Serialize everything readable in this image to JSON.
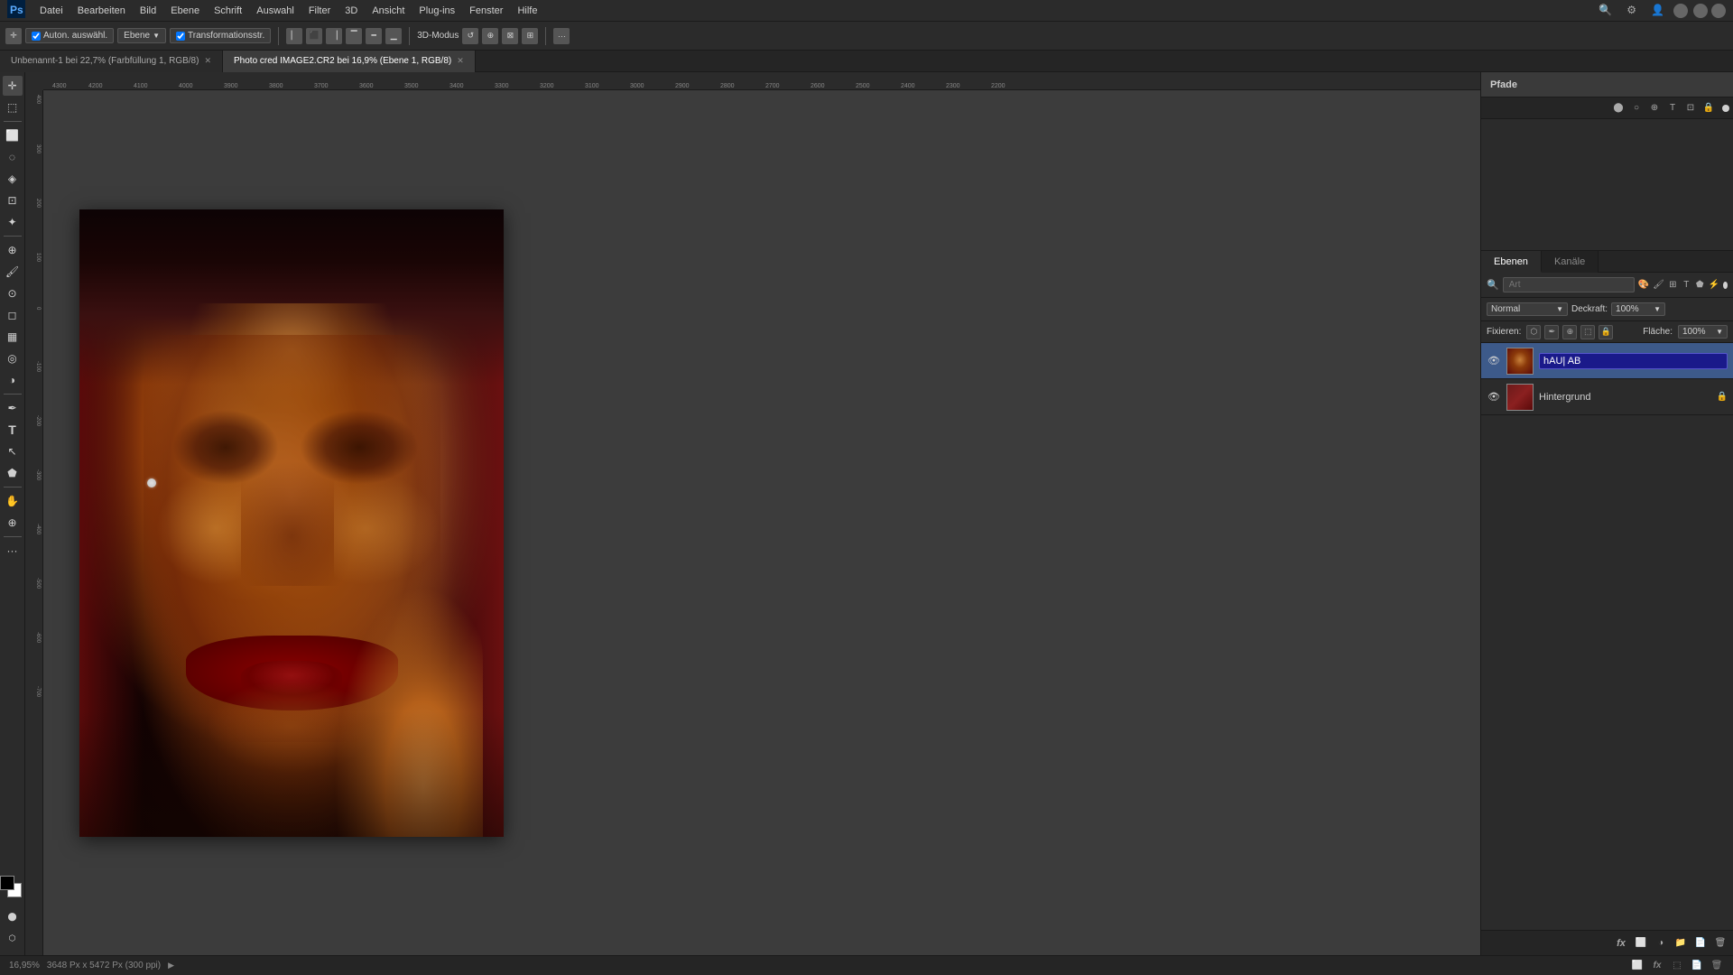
{
  "app": {
    "title": "Adobe Photoshop",
    "menu": [
      "Datei",
      "Bearbeiten",
      "Bild",
      "Ebene",
      "Schrift",
      "Auswahl",
      "Filter",
      "3D",
      "Ansicht",
      "Plug-ins",
      "Fenster",
      "Hilfe"
    ]
  },
  "tabs": [
    {
      "label": "Unbenannt-1 bei 22,7% (Farbfüllung 1, RGB/8)",
      "active": false,
      "modified": true
    },
    {
      "label": "Photo cred IMAGE2.CR2 bei 16,9% (Ebene 1, RGB/8)",
      "active": true,
      "modified": true
    }
  ],
  "optionsbar": {
    "auto_label": "Auton. auswähl.",
    "ebene_label": "Ebene",
    "transformations_label": "Transformationsstr.",
    "mode_3d_label": "3D-Modus"
  },
  "paths_panel": {
    "title": "Pfade"
  },
  "layers_panel": {
    "tabs": [
      {
        "label": "Ebenen",
        "active": true
      },
      {
        "label": "Kanäle",
        "active": false
      }
    ],
    "search_placeholder": "Art",
    "blend_mode": "Normal",
    "opacity_label": "Deckraft:",
    "opacity_value": "100%",
    "lock_label": "Fixieren:",
    "flaeche_label": "Fläche:",
    "flaeche_value": "100%",
    "layers": [
      {
        "name": "hAU| AB",
        "editing": true,
        "visible": true,
        "selected": true,
        "has_thumbnail": true
      },
      {
        "name": "Hintergrund",
        "editing": false,
        "visible": true,
        "selected": false,
        "locked": true,
        "has_thumbnail": true
      }
    ]
  },
  "statusbar": {
    "zoom": "16,95%",
    "dimensions": "3648 Px x 5472 Px (300 ppi)"
  },
  "icons": {
    "eye": "👁",
    "lock": "🔒",
    "search": "🔍",
    "move": "✛",
    "arrow": "↗",
    "pen": "✒",
    "brush": "⌀",
    "eraser": "◻",
    "crop": "⊡",
    "zoom": "⊕",
    "hand": "✋",
    "text": "T",
    "shape": "⬟",
    "gradient": "▦",
    "eyedrop": "✦",
    "heal": "⊕",
    "dodge": "◑",
    "lasso": "◌",
    "magic": "✱",
    "quick_sel": "◈",
    "smart": "⚡",
    "patch": "⊞",
    "stamp": "⊙",
    "blur": "◎",
    "pen_path": "⬡",
    "direct_sel": "↖",
    "custom_shape": "⬖",
    "fg_color": "#000000",
    "bg_color": "#ffffff"
  }
}
